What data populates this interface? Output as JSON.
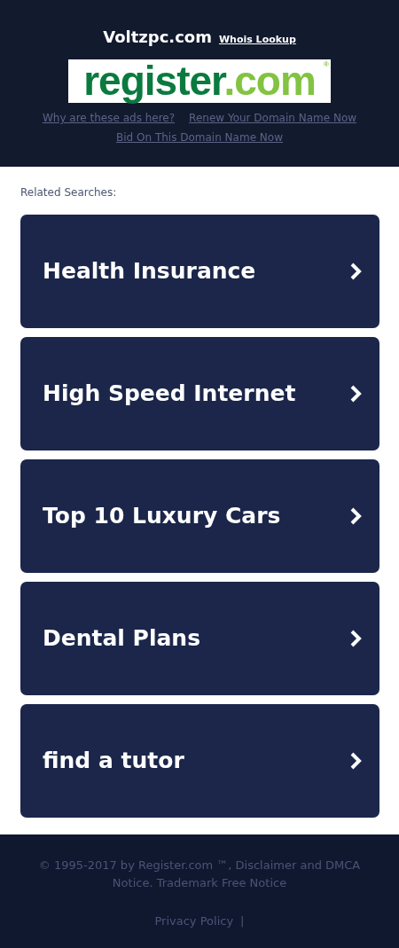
{
  "header": {
    "domain": "Voltzpc.com",
    "whois_link": "Whois Lookup",
    "logo": {
      "main": "register",
      "suffix": ".com",
      "mark": "®"
    },
    "links": [
      "Why are these ads here?",
      "Renew Your Domain Name Now",
      "Bid On This Domain Name Now"
    ]
  },
  "related": {
    "heading": "Related Searches:",
    "items": [
      {
        "label": "Health Insurance"
      },
      {
        "label": "High Speed Internet"
      },
      {
        "label": "Top 10 Luxury Cars"
      },
      {
        "label": "Dental Plans"
      },
      {
        "label": "find a tutor"
      }
    ]
  },
  "footer": {
    "notice": "© 1995-2017 by Register.com ™, Disclaimer and DMCA Notice. Trademark Free Notice",
    "privacy_link": "Privacy Policy",
    "separator": "|"
  }
}
